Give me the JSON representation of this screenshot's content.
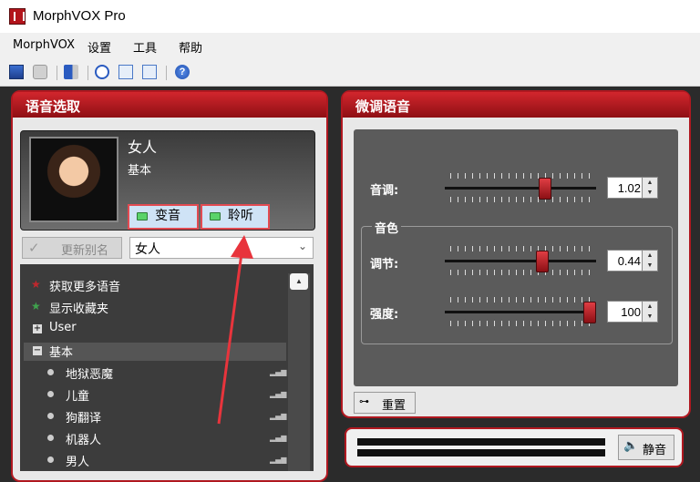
{
  "app": {
    "title": "MorphVOX Pro",
    "icon": "morphvox-logo-icon"
  },
  "menu": [
    "MorphVOX",
    "设置",
    "工具",
    "帮助"
  ],
  "toolbar_icons": [
    "save-icon",
    "disk-icon",
    "plug-icon",
    "timer-icon",
    "waveform-icon",
    "sound-icon",
    "help-icon"
  ],
  "voice_panel": {
    "title": "语音选取",
    "voice_name": "女人",
    "voice_category": "基本",
    "morph_label": "变音",
    "listen_label": "聆听",
    "update_alias_label": "更新别名",
    "alias_value": "女人",
    "list": [
      {
        "label": "获取更多语音",
        "icon": "red-star-icon"
      },
      {
        "label": "显示收藏夹",
        "icon": "green-star-icon"
      },
      {
        "label": "User",
        "icon": "expand-icon"
      },
      {
        "label": "基本",
        "icon": "collapse-icon",
        "selected": true
      },
      {
        "label": "地狱恶魔",
        "icon": "bullet-icon"
      },
      {
        "label": "儿童",
        "icon": "bullet-icon"
      },
      {
        "label": "狗翻译",
        "icon": "bullet-icon"
      },
      {
        "label": "机器人",
        "icon": "bullet-icon"
      },
      {
        "label": "男人",
        "icon": "bullet-icon"
      }
    ]
  },
  "tune_panel": {
    "title": "微调语音",
    "pitch_label": "音调:",
    "pitch_value": "1.02",
    "pitch_level": 0.68,
    "timbre_group": "音色",
    "adjust_label": "调节:",
    "adjust_value": "0.44",
    "adjust_level": 0.66,
    "strength_label": "强度:",
    "strength_value": "100",
    "strength_level": 1.0,
    "reset_label": "重置"
  },
  "mute_label": "静音",
  "colors": {
    "accent_red": "#b01820",
    "highlight": "#e24b52"
  }
}
